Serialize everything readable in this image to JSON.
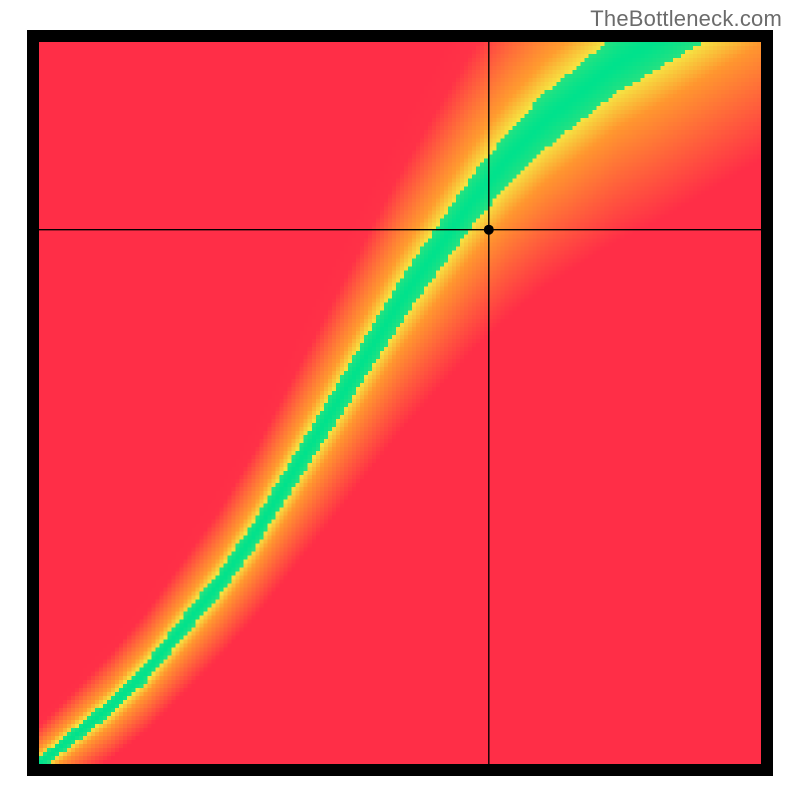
{
  "watermark": "TheBottleneck.com",
  "chart_data": {
    "type": "heatmap",
    "title": "",
    "xlabel": "",
    "ylabel": "",
    "xlim": [
      0,
      1
    ],
    "ylim": [
      0,
      1
    ],
    "grid": false,
    "crosshair": {
      "x": 0.623,
      "y": 0.74
    },
    "marker": {
      "x": 0.623,
      "y": 0.74
    },
    "ideal_curve": {
      "description": "green optimal band where y tracks the ideal value for x",
      "points": [
        {
          "x": 0.0,
          "y": 0.0
        },
        {
          "x": 0.05,
          "y": 0.04
        },
        {
          "x": 0.1,
          "y": 0.08
        },
        {
          "x": 0.15,
          "y": 0.13
        },
        {
          "x": 0.2,
          "y": 0.19
        },
        {
          "x": 0.25,
          "y": 0.25
        },
        {
          "x": 0.3,
          "y": 0.32
        },
        {
          "x": 0.35,
          "y": 0.4
        },
        {
          "x": 0.4,
          "y": 0.48
        },
        {
          "x": 0.45,
          "y": 0.56
        },
        {
          "x": 0.5,
          "y": 0.64
        },
        {
          "x": 0.55,
          "y": 0.71
        },
        {
          "x": 0.6,
          "y": 0.78
        },
        {
          "x": 0.65,
          "y": 0.84
        },
        {
          "x": 0.7,
          "y": 0.89
        },
        {
          "x": 0.75,
          "y": 0.93
        },
        {
          "x": 0.8,
          "y": 0.97
        },
        {
          "x": 0.85,
          "y": 1.0
        }
      ]
    },
    "band_half_width_y": 0.035,
    "colors": {
      "optimal": "#00e28c",
      "near": "#f5e542",
      "mid": "#ff9a2e",
      "far": "#ff2e47"
    }
  }
}
